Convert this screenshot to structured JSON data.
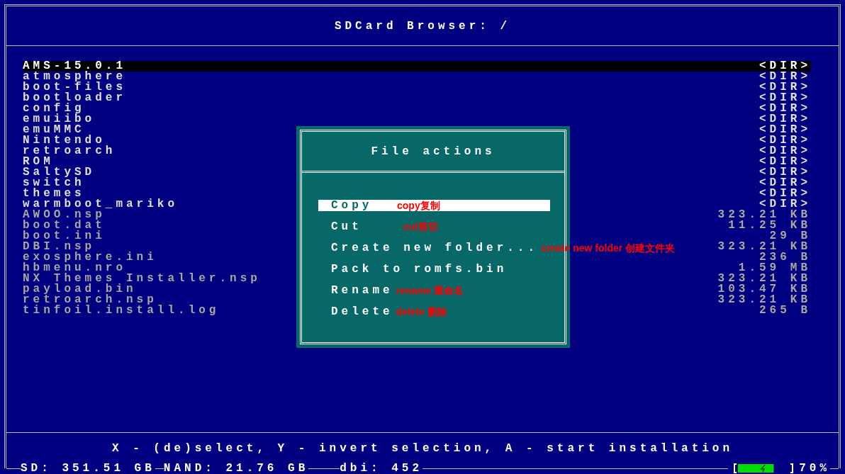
{
  "title": "SDCard Browser: /",
  "entries": [
    {
      "name": "AMS-15.0.1",
      "size": "<DIR>",
      "kind": "dir",
      "selected": true
    },
    {
      "name": "atmosphere",
      "size": "<DIR>",
      "kind": "dir",
      "selected": false
    },
    {
      "name": "boot-files",
      "size": "<DIR>",
      "kind": "dir",
      "selected": false
    },
    {
      "name": "bootloader",
      "size": "<DIR>",
      "kind": "dir",
      "selected": false
    },
    {
      "name": "config",
      "size": "<DIR>",
      "kind": "dir",
      "selected": false
    },
    {
      "name": "emuiibo",
      "size": "<DIR>",
      "kind": "dir",
      "selected": false
    },
    {
      "name": "emuMMC",
      "size": "<DIR>",
      "kind": "dir",
      "selected": false
    },
    {
      "name": "Nintendo",
      "size": "<DIR>",
      "kind": "dir",
      "selected": false
    },
    {
      "name": "retroarch",
      "size": "<DIR>",
      "kind": "dir",
      "selected": false
    },
    {
      "name": "ROM",
      "size": "<DIR>",
      "kind": "dir",
      "selected": false
    },
    {
      "name": "SaltySD",
      "size": "<DIR>",
      "kind": "dir",
      "selected": false
    },
    {
      "name": "switch",
      "size": "<DIR>",
      "kind": "dir",
      "selected": false
    },
    {
      "name": "themes",
      "size": "<DIR>",
      "kind": "dir",
      "selected": false
    },
    {
      "name": "warmboot_mariko",
      "size": "<DIR>",
      "kind": "dir",
      "selected": false
    },
    {
      "name": "AWOO.nsp",
      "size": "323.21 KB",
      "kind": "file",
      "selected": false
    },
    {
      "name": "boot.dat",
      "size": "11.25 KB",
      "kind": "file",
      "selected": false
    },
    {
      "name": "boot.ini",
      "size": "29 B",
      "kind": "file",
      "selected": false
    },
    {
      "name": "DBI.nsp",
      "size": "323.21 KB",
      "kind": "file",
      "selected": false
    },
    {
      "name": "exosphere.ini",
      "size": "236 B",
      "kind": "file",
      "selected": false
    },
    {
      "name": "hbmenu.nro",
      "size": "1.59 MB",
      "kind": "file",
      "selected": false
    },
    {
      "name": "NX Themes Installer.nsp",
      "size": "323.21 KB",
      "kind": "file",
      "selected": false
    },
    {
      "name": "payload.bin",
      "size": "103.47 KB",
      "kind": "file",
      "selected": false
    },
    {
      "name": "retroarch.nsp",
      "size": "323.21 KB",
      "kind": "file",
      "selected": false
    },
    {
      "name": "tinfoil.install.log",
      "size": "265 B",
      "kind": "file",
      "selected": false
    }
  ],
  "dialog": {
    "title": "File actions",
    "actions": [
      {
        "label": "Copy",
        "note": "copy复制",
        "selected": true
      },
      {
        "label": "Cut",
        "note": "cut剪切",
        "selected": false
      },
      {
        "label": "Create new folder...",
        "note": "create new folder 创建文件夹",
        "selected": false
      },
      {
        "label": "Pack to romfs.bin",
        "selected": false
      },
      {
        "label": "Rename",
        "note": "rename 重命名",
        "selected": false
      },
      {
        "label": "Delete",
        "note": "delete 删除",
        "selected": false
      }
    ]
  },
  "hint": "X - (de)select, Y - invert selection, A - start installation",
  "status": {
    "sd": "SD: 351.51 GB",
    "nand": "NAND: 21.76 GB",
    "dbi": "dbi: 452",
    "battery": {
      "level": 0.7,
      "charging": true
    },
    "battery_text": "70%"
  }
}
